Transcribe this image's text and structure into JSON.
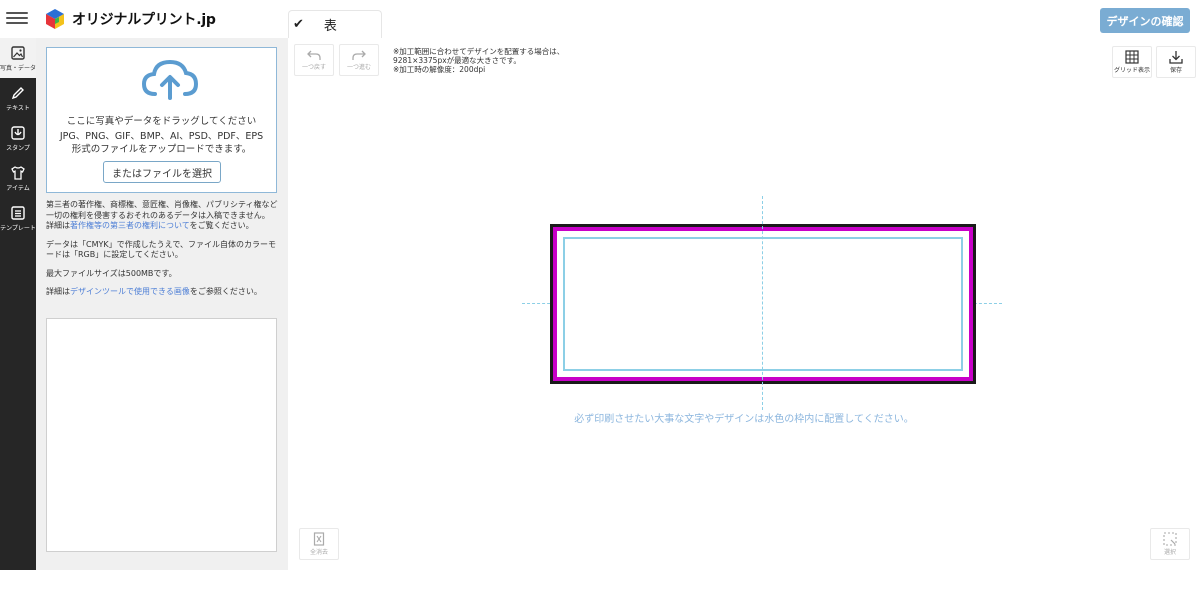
{
  "header": {
    "logo_text": "オリジナルプリント.jp",
    "tab_label": "表",
    "confirm_label": "デザインの確認"
  },
  "rail": {
    "items": [
      {
        "label": "写真・データ",
        "icon": "image-icon"
      },
      {
        "label": "テキスト",
        "icon": "pencil-icon"
      },
      {
        "label": "スタンプ",
        "icon": "stamp-icon"
      },
      {
        "label": "アイテム",
        "icon": "tshirt-icon"
      },
      {
        "label": "テンプレート",
        "icon": "template-icon"
      }
    ]
  },
  "upload": {
    "line1": "ここに写真やデータをドラッグしてください",
    "line2": "JPG、PNG、GIF、BMP、AI、PSD、PDF、EPS",
    "line3": "形式のファイルをアップロードできます。",
    "select_button": "またはファイルを選択"
  },
  "info": {
    "p1": "第三者の著作権、商標権、意匠権、肖像権、パブリシティ権など一切の権利を侵害するおそれのあるデータは入稿できません。",
    "p1b_prefix": "詳細は",
    "p1b_link": "著作権等の第三者の権利について",
    "p1b_suffix": "をご覧ください。",
    "p2": "データは「CMYK」で作成したうえで、ファイル自体のカラーモードは「RGB」に設定してください。",
    "p3": "最大ファイルサイズは500MBです。",
    "p4_prefix": "詳細は",
    "p4_link": "デザインツールで使用できる画像",
    "p4_suffix": "をご参照ください。"
  },
  "toolbar": {
    "undo": "一つ戻す",
    "redo": "一つ進む",
    "grid": "グリッド表示",
    "save": "保存",
    "clear": "全消去",
    "select": "選択"
  },
  "canvas": {
    "note1": "※加工範囲に合わせてデザインを配置する場合は、",
    "note2": "9281×3375pxが最適な大きさです。",
    "note3": "※加工時の解像度：200dpi",
    "safe_area_note": "必ず印刷させたい大事な文字やデザインは水色の枠内に配置してください。"
  },
  "colors": {
    "accent": "#7aacd3",
    "bleed": "#c800c8",
    "safe": "#8ccfe6",
    "link": "#4e7fd6"
  }
}
